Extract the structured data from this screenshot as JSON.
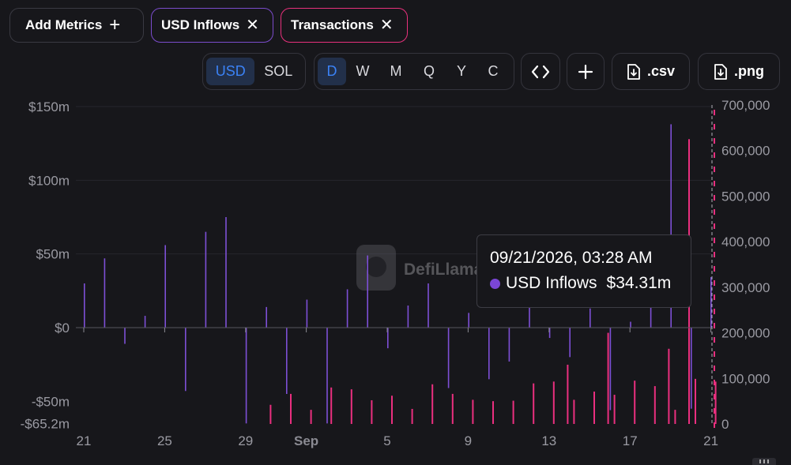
{
  "toolbar": {
    "add_metrics_label": "Add Metrics",
    "metric_chips": [
      {
        "label": "USD Inflows",
        "border_color": "#7b4ccc"
      },
      {
        "label": "Transactions",
        "border_color": "#e8317c"
      }
    ],
    "denomination_options": [
      "USD",
      "SOL"
    ],
    "denomination_selected": "USD",
    "period_options": [
      "D",
      "W",
      "M",
      "Q",
      "Y",
      "C"
    ],
    "period_selected": "D",
    "csv_label": ".csv",
    "png_label": ".png",
    "icons": [
      "plus-icon",
      "close-icon",
      "embed-code-icon",
      "download-icon"
    ]
  },
  "watermark": "DefiLlama",
  "tooltip": {
    "date": "09/21/2026, 03:28 AM",
    "series": "USD Inflows",
    "value": "$34.31m",
    "dot_color": "#7b46d6"
  },
  "chart_data": {
    "type": "bar",
    "title": "",
    "x_tick_labels": [
      "21",
      "25",
      "29",
      "Sep",
      "5",
      "9",
      "13",
      "17",
      "21"
    ],
    "y_left": {
      "series": "USD Inflows",
      "tick_labels": [
        "$150m",
        "$100m",
        "$50m",
        "$0",
        "-$50m",
        "-$65.2m"
      ],
      "ylim": [
        -65.2,
        150
      ],
      "unit": "USD millions"
    },
    "y_right": {
      "series": "Transactions",
      "tick_labels": [
        "700,000",
        "600,000",
        "500,000",
        "400,000",
        "300,000",
        "200,000",
        "100,000",
        "0"
      ],
      "ylim": [
        0,
        700000
      ]
    },
    "grid": true,
    "legend": "none",
    "colors": {
      "USD Inflows": "#7d4fd6",
      "Transactions": "#ea2f7f"
    },
    "series": [
      {
        "name": "USD Inflows",
        "dates": [
          "Aug 21",
          "Aug 22",
          "Aug 23",
          "Aug 24",
          "Aug 25",
          "Aug 26",
          "Aug 27",
          "Aug 28",
          "Aug 29",
          "Aug 30",
          "Aug 31",
          "Sep 1",
          "Sep 2",
          "Sep 3",
          "Sep 4",
          "Sep 5",
          "Sep 6",
          "Sep 7",
          "Sep 8",
          "Sep 9",
          "Sep 10",
          "Sep 11",
          "Sep 12",
          "Sep 13",
          "Sep 14",
          "Sep 15",
          "Sep 16",
          "Sep 17",
          "Sep 18",
          "Sep 19",
          "Sep 20",
          "Sep 21"
        ],
        "values": [
          30,
          47,
          -11,
          8,
          56,
          -43,
          65,
          75,
          -65,
          14,
          -45,
          19,
          -65,
          26,
          49,
          -14,
          15,
          30,
          -41,
          10,
          -35,
          -23,
          14,
          -7,
          -20,
          13,
          -56,
          4,
          15,
          138,
          -55,
          34.31
        ]
      },
      {
        "name": "Transactions",
        "dates": [
          "Aug 30",
          "Aug 31",
          "Sep 1",
          "Sep 2",
          "Sep 3",
          "Sep 4",
          "Sep 5",
          "Sep 6",
          "Sep 7",
          "Sep 8",
          "Sep 9",
          "Sep 10",
          "Sep 11",
          "Sep 12",
          "Sep 13",
          "Sep 14",
          "Sep 15",
          "Sep 16",
          "Sep 17",
          "Sep 18",
          "Sep 19",
          "Sep 20",
          "Sep 21"
        ],
        "values": [
          42000,
          66000,
          31000,
          80000,
          76000,
          52000,
          62000,
          33000,
          87000,
          66000,
          53000,
          50000,
          51000,
          89000,
          93000,
          53000,
          71000,
          64000,
          95000,
          83000,
          31000,
          99000,
          93000
        ]
      }
    ],
    "extra_transactions_spikes": [
      {
        "date": "Sep 14",
        "value": 130000
      },
      {
        "date": "Sep 16",
        "value": 200000
      },
      {
        "date": "Sep 19",
        "value": 165000
      },
      {
        "date": "Sep 20",
        "value": 625000
      }
    ],
    "hover_date": "Sep 21"
  }
}
